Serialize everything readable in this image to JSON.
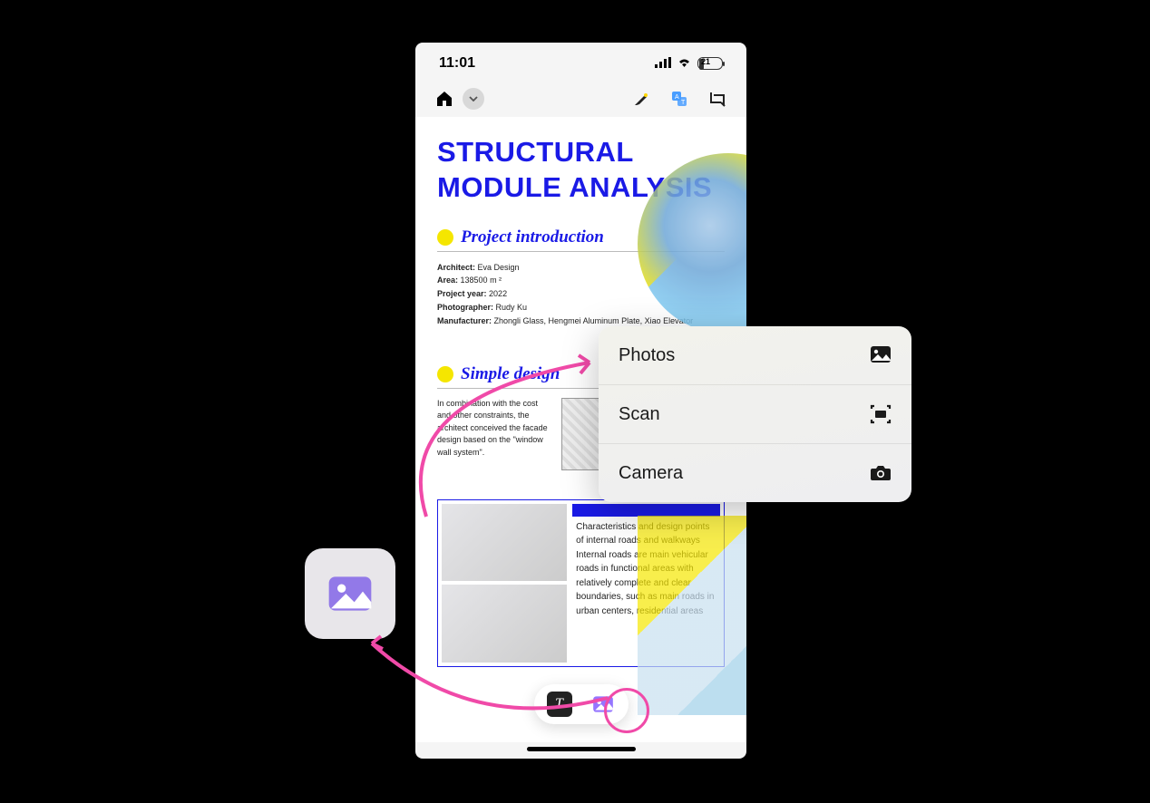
{
  "status_bar": {
    "time": "11:01",
    "battery_percent": "21"
  },
  "document": {
    "title": "STRUCTURAL MODULE ANALYSIS",
    "section1": {
      "title": "Project introduction",
      "meta": {
        "architect_label": "Architect:",
        "architect_value": "Eva Design",
        "area_label": "Area:",
        "area_value": "138500 m ²",
        "year_label": "Project year:",
        "year_value": "2022",
        "photographer_label": "Photographer:",
        "photographer_value": "Rudy Ku",
        "manufacturer_label": "Manufacturer:",
        "manufacturer_value": "Zhongli Glass, Hengmei Aluminum Plate, Xiao Elevator"
      }
    },
    "section2": {
      "title": "Simple design",
      "body": "In combination with the cost and other constraints, the architect conceived the facade design based on the \"window wall system\"."
    },
    "figure_text": "Characteristics and design points of internal roads and walkways Internal roads are main vehicular roads in functional areas with relatively complete and clear boundaries, such as main roads in urban centers, residential areas"
  },
  "context_menu": {
    "items": [
      {
        "label": "Photos",
        "icon": "photo"
      },
      {
        "label": "Scan",
        "icon": "scan"
      },
      {
        "label": "Camera",
        "icon": "camera"
      }
    ]
  },
  "bottom_pill": {
    "text_button": "T"
  }
}
